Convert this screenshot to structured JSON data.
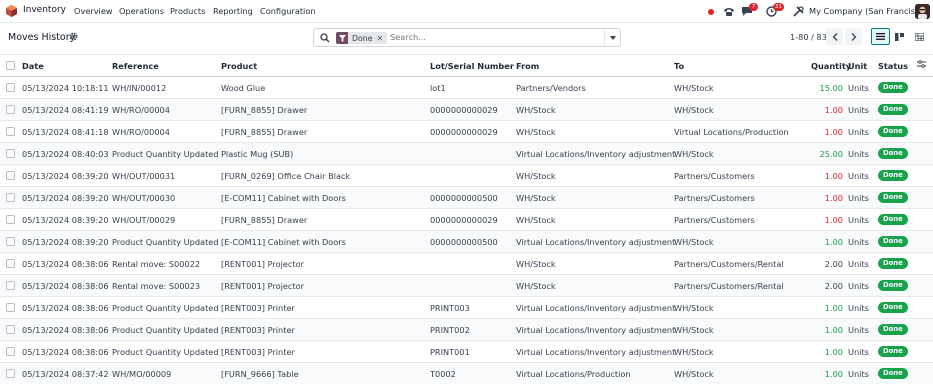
{
  "navbar": {
    "app_name": "Inventory",
    "menu": [
      "Overview",
      "Operations",
      "Products",
      "Reporting",
      "Configuration"
    ],
    "messages_badge": "7",
    "activities_badge": "31",
    "company": "My Company (San Francisco)"
  },
  "control": {
    "title": "Moves History",
    "facet_label": "Done",
    "search_placeholder": "Search...",
    "pager": "1-80 / 83"
  },
  "columns": {
    "date": "Date",
    "reference": "Reference",
    "product": "Product",
    "lot": "Lot/Serial Number",
    "from": "From",
    "to": "To",
    "quantity": "Quantity",
    "unit": "Unit",
    "status": "Status"
  },
  "rows": [
    {
      "date": "05/13/2024 10:18:11",
      "reference": "WH/IN/00012",
      "product": "Wood Glue",
      "lot": "lot1",
      "from": "Partners/Vendors",
      "to": "WH/Stock",
      "quantity": "15.00",
      "qty_color": "green",
      "unit": "Units",
      "status": "Done"
    },
    {
      "date": "05/13/2024 08:41:19",
      "reference": "WH/RO/00004",
      "product": "[FURN_8855] Drawer",
      "lot": "0000000000029",
      "from": "WH/Stock",
      "to": "WH/Stock",
      "quantity": "1.00",
      "qty_color": "red",
      "unit": "Units",
      "status": "Done"
    },
    {
      "date": "05/13/2024 08:41:18",
      "reference": "WH/RO/00004",
      "product": "[FURN_8855] Drawer",
      "lot": "0000000000029",
      "from": "WH/Stock",
      "to": "Virtual Locations/Production",
      "quantity": "1.00",
      "qty_color": "red",
      "unit": "Units",
      "status": "Done"
    },
    {
      "date": "05/13/2024 08:40:03",
      "reference": "Product Quantity Updated",
      "product": "Plastic Mug (SUB)",
      "lot": "",
      "from": "Virtual Locations/Inventory adjustment",
      "to": "WH/Stock",
      "quantity": "25.00",
      "qty_color": "green",
      "unit": "Units",
      "status": "Done"
    },
    {
      "date": "05/13/2024 08:39:20",
      "reference": "WH/OUT/00031",
      "product": "[FURN_0269] Office Chair Black",
      "lot": "",
      "from": "WH/Stock",
      "to": "Partners/Customers",
      "quantity": "1.00",
      "qty_color": "red",
      "unit": "Units",
      "status": "Done"
    },
    {
      "date": "05/13/2024 08:39:20",
      "reference": "WH/OUT/00030",
      "product": "[E-COM11] Cabinet with Doors",
      "lot": "0000000000500",
      "from": "WH/Stock",
      "to": "Partners/Customers",
      "quantity": "1.00",
      "qty_color": "red",
      "unit": "Units",
      "status": "Done"
    },
    {
      "date": "05/13/2024 08:39:20",
      "reference": "WH/OUT/00029",
      "product": "[FURN_8855] Drawer",
      "lot": "0000000000029",
      "from": "WH/Stock",
      "to": "Partners/Customers",
      "quantity": "1.00",
      "qty_color": "red",
      "unit": "Units",
      "status": "Done"
    },
    {
      "date": "05/13/2024 08:39:20",
      "reference": "Product Quantity Updated",
      "product": "[E-COM11] Cabinet with Doors",
      "lot": "0000000000500",
      "from": "Virtual Locations/Inventory adjustment",
      "to": "WH/Stock",
      "quantity": "1.00",
      "qty_color": "green",
      "unit": "Units",
      "status": "Done"
    },
    {
      "date": "05/13/2024 08:38:06",
      "reference": "Rental move: S00022",
      "product": "[RENT001] Projector",
      "lot": "",
      "from": "WH/Stock",
      "to": "Partners/Customers/Rental",
      "quantity": "2.00",
      "qty_color": "plain",
      "unit": "Units",
      "status": "Done"
    },
    {
      "date": "05/13/2024 08:38:06",
      "reference": "Rental move: S00023",
      "product": "[RENT001] Projector",
      "lot": "",
      "from": "WH/Stock",
      "to": "Partners/Customers/Rental",
      "quantity": "2.00",
      "qty_color": "plain",
      "unit": "Units",
      "status": "Done"
    },
    {
      "date": "05/13/2024 08:38:06",
      "reference": "Product Quantity Updated",
      "product": "[RENT003] Printer",
      "lot": "PRINT003",
      "from": "Virtual Locations/Inventory adjustment",
      "to": "WH/Stock",
      "quantity": "1.00",
      "qty_color": "green",
      "unit": "Units",
      "status": "Done"
    },
    {
      "date": "05/13/2024 08:38:06",
      "reference": "Product Quantity Updated",
      "product": "[RENT003] Printer",
      "lot": "PRINT002",
      "from": "Virtual Locations/Inventory adjustment",
      "to": "WH/Stock",
      "quantity": "1.00",
      "qty_color": "green",
      "unit": "Units",
      "status": "Done"
    },
    {
      "date": "05/13/2024 08:38:06",
      "reference": "Product Quantity Updated",
      "product": "[RENT003] Printer",
      "lot": "PRINT001",
      "from": "Virtual Locations/Inventory adjustment",
      "to": "WH/Stock",
      "quantity": "1.00",
      "qty_color": "green",
      "unit": "Units",
      "status": "Done"
    },
    {
      "date": "05/13/2024 08:37:42",
      "reference": "WH/MO/00009",
      "product": "[FURN_9666] Table",
      "lot": "T0002",
      "from": "Virtual Locations/Production",
      "to": "WH/Stock",
      "quantity": "1.00",
      "qty_color": "green",
      "unit": "Units",
      "status": "Done"
    }
  ],
  "colors": {
    "brand": "#714b67",
    "accent": "#017e84",
    "done": "#16a34a",
    "negative": "#dc2626"
  }
}
